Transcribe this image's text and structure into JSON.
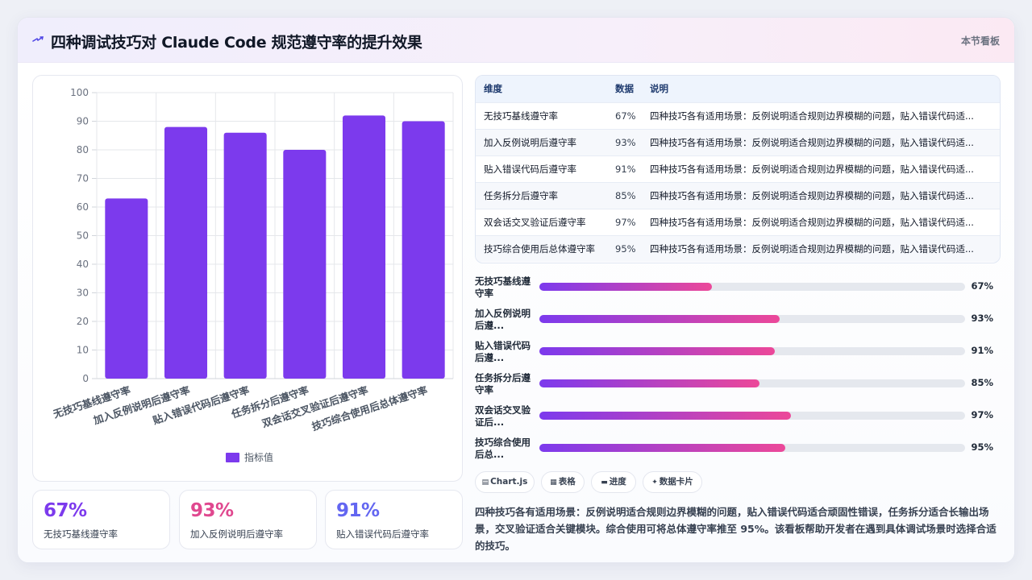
{
  "header": {
    "title": "四种调试技巧对 Claude Code 规范遵守率的提升效果",
    "tag": "本节看板",
    "icon": "lightning-icon"
  },
  "chart_data": {
    "type": "bar",
    "categories": [
      "无技巧基线遵守率",
      "加入反例说明后遵守率",
      "贴入错误代码后遵守率",
      "任务拆分后遵守率",
      "双会话交叉验证后遵守率",
      "技巧综合使用后总体遵守率"
    ],
    "series": [
      {
        "name": "指标值",
        "values": [
          63,
          88,
          86,
          80,
          92,
          90
        ]
      }
    ],
    "ylim": [
      0,
      100
    ],
    "yticks": [
      0,
      10,
      20,
      30,
      40,
      50,
      60,
      70,
      80,
      90,
      100
    ],
    "grid": true,
    "legend": "bottom",
    "color": "#7c3aed"
  },
  "kpis": [
    {
      "value": "67%",
      "label": "无技巧基线遵守率",
      "color": "#7c3aed"
    },
    {
      "value": "93%",
      "label": "加入反例说明后遵守率",
      "color": "#e0488f"
    },
    {
      "value": "91%",
      "label": "贴入错误代码后遵守率",
      "color": "#6366f1"
    }
  ],
  "table": {
    "headers": [
      "维度",
      "数据",
      "说明"
    ],
    "rows": [
      [
        "无技巧基线遵守率",
        "67%",
        "四种技巧各有适用场景：反例说明适合规则边界模糊的问题，贴入错误代码适..."
      ],
      [
        "加入反例说明后遵守率",
        "93%",
        "四种技巧各有适用场景：反例说明适合规则边界模糊的问题，贴入错误代码适..."
      ],
      [
        "贴入错误代码后遵守率",
        "91%",
        "四种技巧各有适用场景：反例说明适合规则边界模糊的问题，贴入错误代码适..."
      ],
      [
        "任务拆分后遵守率",
        "85%",
        "四种技巧各有适用场景：反例说明适合规则边界模糊的问题，贴入错误代码适..."
      ],
      [
        "双会话交叉验证后遵守率",
        "97%",
        "四种技巧各有适用场景：反例说明适合规则边界模糊的问题，贴入错误代码适..."
      ],
      [
        "技巧综合使用后总体遵守率",
        "95%",
        "四种技巧各有适用场景：反例说明适合规则边界模糊的问题，贴入错误代码适..."
      ]
    ]
  },
  "progress": [
    {
      "label": "无技巧基线遵守率",
      "value": "67%",
      "fill": 0.405
    },
    {
      "label": "加入反例说明后遵...",
      "value": "93%",
      "fill": 0.565
    },
    {
      "label": "贴入错误代码后遵...",
      "value": "91%",
      "fill": 0.553
    },
    {
      "label": "任务拆分后遵守率",
      "value": "85%",
      "fill": 0.517
    },
    {
      "label": "双会话交叉验证后...",
      "value": "97%",
      "fill": 0.59
    },
    {
      "label": "技巧综合使用后总...",
      "value": "95%",
      "fill": 0.578
    }
  ],
  "pills": [
    {
      "icon": "chart-icon",
      "glyph": "▤",
      "label": "Chart.js"
    },
    {
      "icon": "table-icon",
      "glyph": "▦",
      "label": "表格"
    },
    {
      "icon": "progress-icon",
      "glyph": "▬",
      "label": "进度"
    },
    {
      "icon": "sparkle-icon",
      "glyph": "✦",
      "label": "数据卡片"
    }
  ],
  "note": "四种技巧各有适用场景：反例说明适合规则边界模糊的问题，贴入错误代码适合顽固性错误，任务拆分适合长输出场景，交叉验证适合关键模块。综合使用可将总体遵守率推至 95%。该看板帮助开发者在遇到具体调试场景时选择合适的技巧。"
}
